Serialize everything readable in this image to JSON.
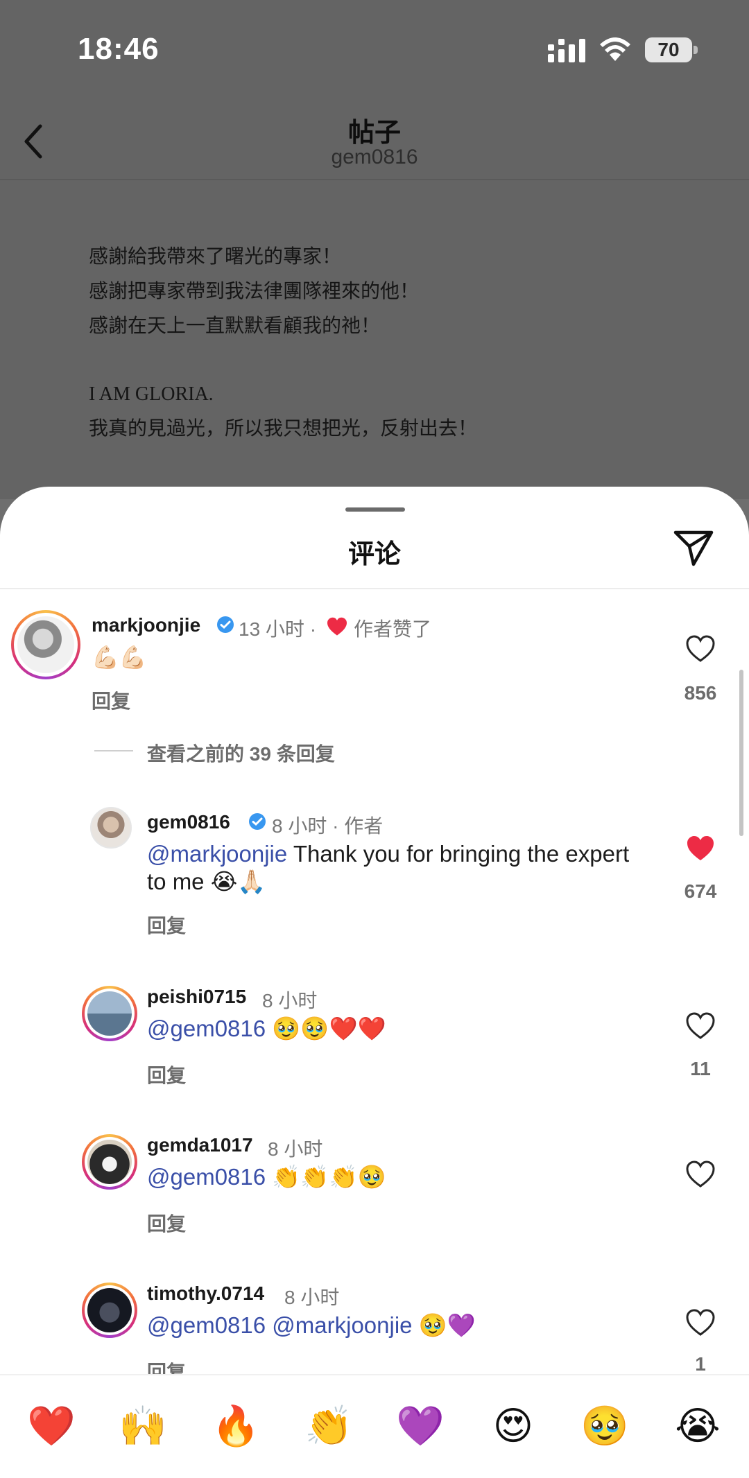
{
  "status_bar": {
    "time": "18:46",
    "battery": "70"
  },
  "post_header": {
    "title": "帖子",
    "subtitle": "gem0816"
  },
  "caption": {
    "line1": "感謝給我帶來了曙光的專家！",
    "line2": "感謝把專家帶到我法律團隊裡來的他！",
    "line3": "感謝在天上一直默默看顧我的祂！",
    "line4": "I AM GLORIA.",
    "line5": "我真的見過光，所以我只想把光，反射出去！"
  },
  "sheet": {
    "title": "评论"
  },
  "comments": [
    {
      "user": "markjoonjie",
      "time": "13 小时 ·",
      "author_liked": "作者赞了",
      "text": "💪🏻💪🏻",
      "reply": "回复",
      "likes": "856",
      "liked": false
    },
    {
      "user": "gem0816",
      "time": "8 小时 · 作者",
      "mention": "@markjoonjie",
      "text": " Thank you for bringing the expert to me 😭🙏🏻",
      "reply": "回复",
      "likes": "674",
      "liked": true
    },
    {
      "user": "peishi0715",
      "time": "8 小时",
      "mention": "@gem0816",
      "text": " 🥹🥹❤️❤️",
      "reply": "回复",
      "likes": "11",
      "liked": false
    },
    {
      "user": "gemda1017",
      "time": "8 小时",
      "mention": "@gem0816",
      "text": " 👏👏👏🥹",
      "reply": "回复",
      "likes": "",
      "liked": false
    },
    {
      "user": "timothy.0714",
      "time": "8 小时",
      "mention": "@gem0816 @markjoonjie",
      "text": " 🥹💜",
      "reply": "回复",
      "likes": "1",
      "liked": false
    }
  ],
  "view_replies": "查看之前的 39 条回复",
  "reactions": [
    "❤️",
    "🙌",
    "🔥",
    "👏",
    "💜",
    "😍",
    "🥹",
    "😭"
  ],
  "colors": {
    "heart_liked": "#ed2b45",
    "mention": "#3a4fa8",
    "verified": "#3897f0"
  }
}
